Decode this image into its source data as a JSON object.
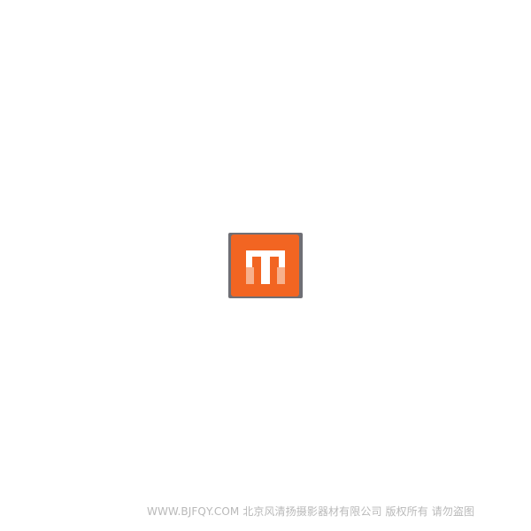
{
  "icon": {
    "name": "app-logo-icon",
    "colors": {
      "background": "#f26522",
      "border": "#6f6f75",
      "glyph_light": "#ffffff",
      "glyph_mid": "#f7b08c"
    }
  },
  "watermark": {
    "text": "WWW.BJFQY.COM 北京风清扬摄影器材有限公司 版权所有 请勿盗图"
  }
}
